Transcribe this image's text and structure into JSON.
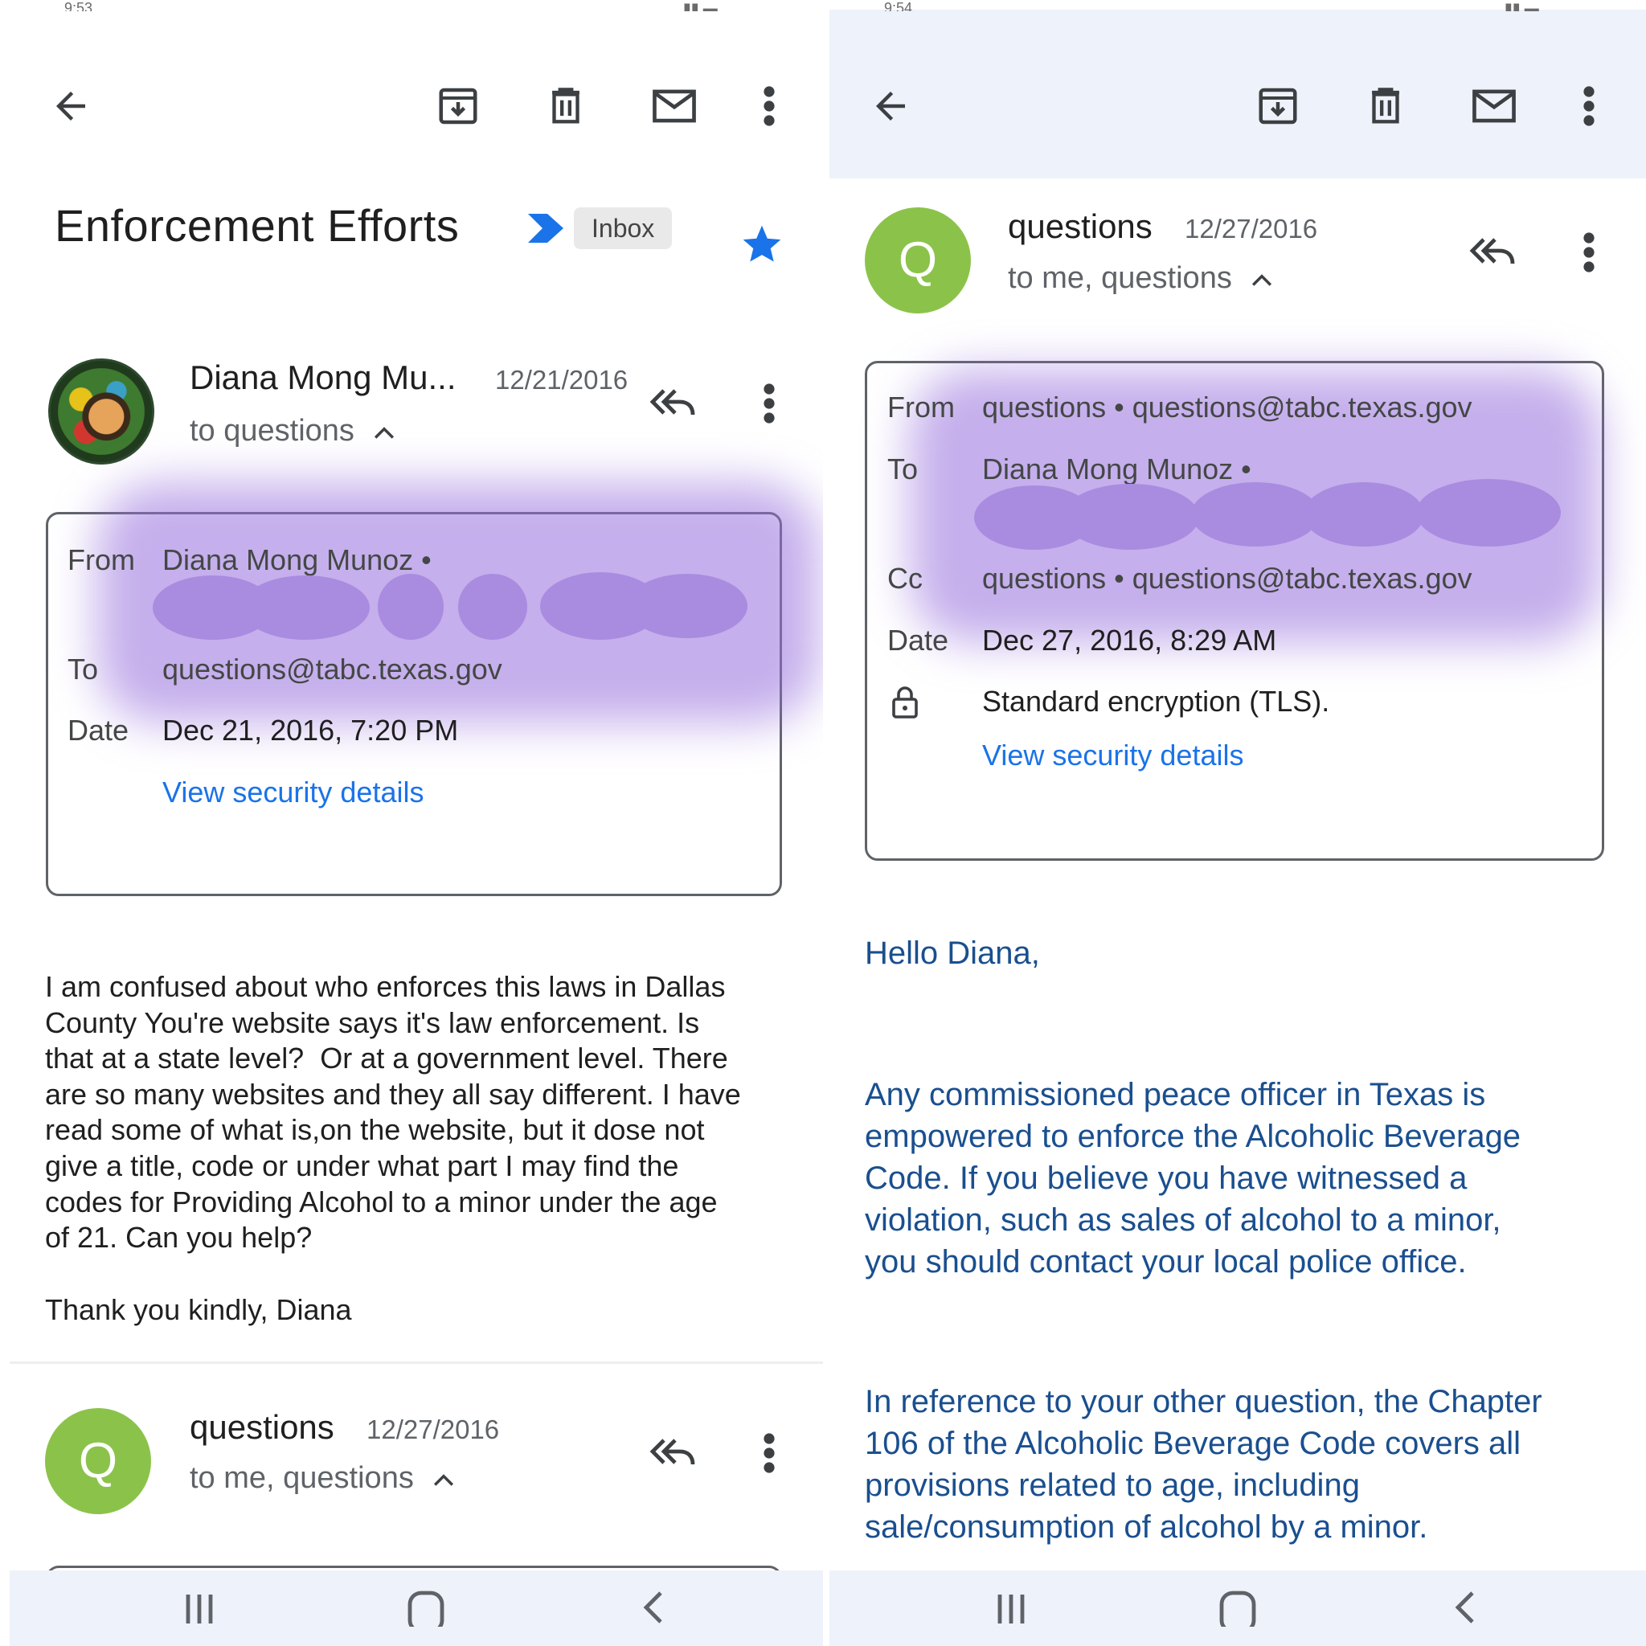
{
  "left": {
    "status_bar": {
      "time": "9:53"
    },
    "toolbar": {
      "back_icon": "arrow-left-icon",
      "archive_icon": "archive-icon",
      "delete_icon": "trash-icon",
      "mark_unread_icon": "mail-icon",
      "more_icon": "more-vert-icon"
    },
    "subject": "Enforcement Efforts",
    "label_chip": "Inbox",
    "starred": true,
    "message1": {
      "sender": "Diana Mong Mu...",
      "date": "12/21/2016",
      "recipients": "to questions",
      "details": {
        "from_label": "From",
        "from_value": "Diana Mong Munoz •",
        "to_label": "To",
        "to_value": "questions@tabc.texas.gov",
        "date_label": "Date",
        "date_value": "Dec 21, 2016, 7:20 PM",
        "security_link": "View security details"
      },
      "body": [
        "I am confused about who enforces this laws in Dallas",
        "County You're website says it's law enforcement. Is",
        "that at a state level?  Or at a government level. There",
        "are so many websites and they all say different. I have",
        "read some of what is,on the website, but it dose not",
        "give a title, code or under what part I may find the",
        "codes for Providing Alcohol to a minor under the age",
        "of 21. Can you help?"
      ],
      "signoff": "Thank you kindly, Diana"
    },
    "message2": {
      "avatar_letter": "Q",
      "sender": "questions",
      "date": "12/27/2016",
      "recipients": "to me, questions"
    }
  },
  "right": {
    "status_bar": {
      "time": "9:54"
    },
    "message": {
      "avatar_letter": "Q",
      "sender": "questions",
      "date": "12/27/2016",
      "recipients": "to me, questions",
      "details": {
        "from_label": "From",
        "from_value": "questions • questions@tabc.texas.gov",
        "to_label": "To",
        "to_value": "Diana Mong Munoz •",
        "cc_label": "Cc",
        "cc_value": "questions • questions@tabc.texas.gov",
        "date_label": "Date",
        "date_value": "Dec 27, 2016, 8:29 AM",
        "encryption": "Standard encryption (TLS).",
        "security_link": "View security details"
      },
      "greeting": "Hello Diana,",
      "para1": [
        "Any commissioned peace officer in Texas is",
        "empowered to enforce the Alcoholic Beverage",
        "Code. If you believe you have witnessed a",
        "violation, such as sales of alcohol to a minor,",
        "you should contact your local police office."
      ],
      "para2": [
        "In reference to your other question, the Chapter",
        "106 of the Alcoholic Beverage Code covers all",
        "provisions related to age, including",
        "sale/consumption of alcohol by a minor."
      ]
    }
  },
  "navbar": {
    "recents_icon": "recents-icon",
    "home_icon": "home-icon",
    "back_icon": "nav-back-icon"
  },
  "colors": {
    "accent_blue": "#1a73e8",
    "reply_text_blue": "#1a4f8f",
    "avatar_green": "#8bc34a",
    "redaction_purple": "#a98be0",
    "toolbar_bg": "#eef2fa"
  }
}
